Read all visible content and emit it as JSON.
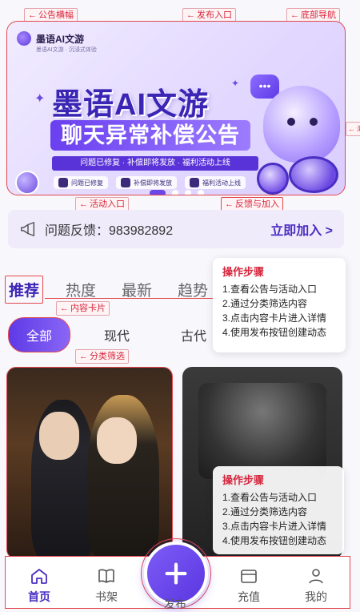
{
  "annotations": {
    "banner": "公告横幅",
    "publish": "发布入口",
    "bottom_nav": "底部导航",
    "activity": "活动入口",
    "feedback_join": "反馈与加入",
    "content_card": "内容卡片",
    "category_filter": "分类筛选",
    "right_edge": "海"
  },
  "banner": {
    "brand": "墨语AI文游",
    "brand_sub": "墨语AI文游 · 沉浸式体验",
    "title": "墨语AI文游",
    "subtitle": "聊天异常补偿公告",
    "notice": "问题已修复 · 补偿即将发放 · 福利活动上线",
    "chips": [
      "问题已修复",
      "补偿即将发放",
      "福利活动上线"
    ],
    "bubble": "•••",
    "page_count": 4,
    "active_page": 0
  },
  "feedback": {
    "text": "问题反馈：983982892",
    "join": "立即加入 >"
  },
  "tabs": [
    {
      "label": "推荐",
      "active": true
    },
    {
      "label": "热度",
      "active": false
    },
    {
      "label": "最新",
      "active": false
    },
    {
      "label": "趋势",
      "active": false
    }
  ],
  "categories": [
    {
      "label": "全部",
      "active": true
    },
    {
      "label": "现代",
      "active": false
    },
    {
      "label": "古代",
      "active": false
    }
  ],
  "steps": {
    "title": "操作步骤",
    "items": [
      "1.查看公告与活动入口",
      "2.通过分类筛选内容",
      "3.点击内容卡片进入详情",
      "4.使用发布按钮创建动态"
    ]
  },
  "nav": {
    "home": "首页",
    "shelf": "书架",
    "publish": "发布",
    "recharge": "充值",
    "mine": "我的"
  },
  "colors": {
    "accent": "#5a36e0",
    "annotation": "#d7263d"
  }
}
